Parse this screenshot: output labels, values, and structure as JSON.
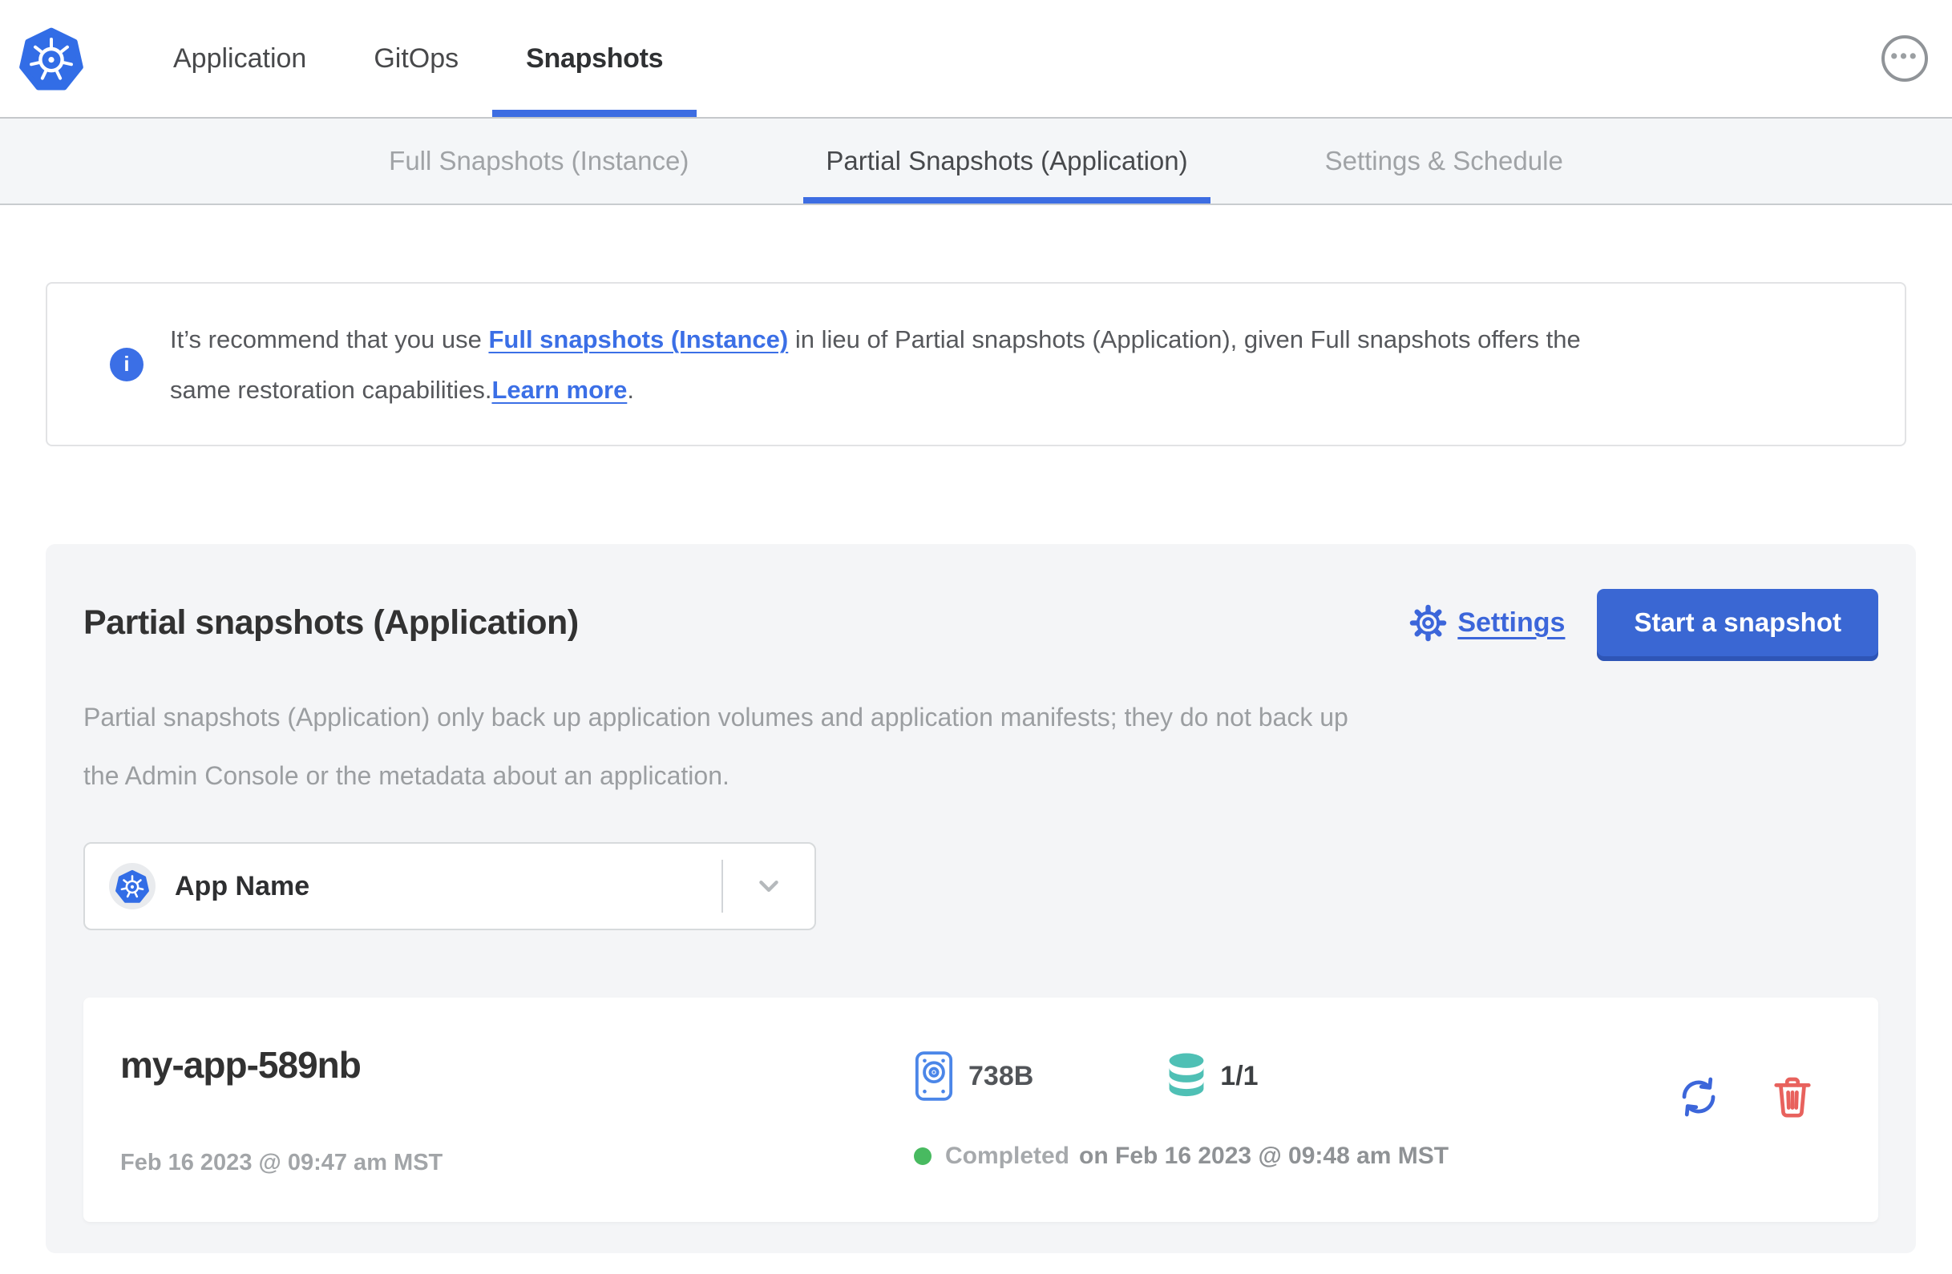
{
  "header": {
    "nav": [
      {
        "label": "Application",
        "active": false
      },
      {
        "label": "GitOps",
        "active": false
      },
      {
        "label": "Snapshots",
        "active": true
      }
    ]
  },
  "subnav": {
    "tabs": [
      {
        "label": "Full Snapshots (Instance)",
        "active": false
      },
      {
        "label": "Partial Snapshots (Application)",
        "active": true
      },
      {
        "label": "Settings & Schedule",
        "active": false
      }
    ]
  },
  "banner": {
    "line1_pre": "It’s recommend that you use ",
    "line1_link": "Full snapshots (Instance)",
    "line1_post": " in lieu of Partial snapshots (Application), given Full snapshots offers the",
    "line2_pre": "same restoration capabilities.",
    "line2_link": "Learn more",
    "line2_post": "."
  },
  "panel": {
    "title": "Partial snapshots (Application)",
    "settings_label": "Settings",
    "start_button_label": "Start a snapshot",
    "description_line1": "Partial snapshots (Application) only back up application volumes and application manifests; they do not back up",
    "description_line2": "the Admin Console or the metadata about an application.",
    "app_selector": {
      "value": "App Name"
    },
    "snapshot": {
      "name": "my-app-589nb",
      "started_at": "Feb 16 2023 @ 09:47 am MST",
      "size": "738B",
      "volume_count": "1/1",
      "status": "Completed",
      "completed_at": "on Feb 16 2023 @ 09:48 am MST"
    }
  },
  "icons": {
    "ellipsis": "•••",
    "info": "i"
  },
  "colors": {
    "kubernetes_blue": "#326de6",
    "accent_blue": "#3c66da",
    "link_blue": "#3b6fe6",
    "button_blue": "#3a67d3",
    "volume_teal": "#4fc0b5",
    "success_green": "#48ba60",
    "danger_red": "#e8625d"
  }
}
